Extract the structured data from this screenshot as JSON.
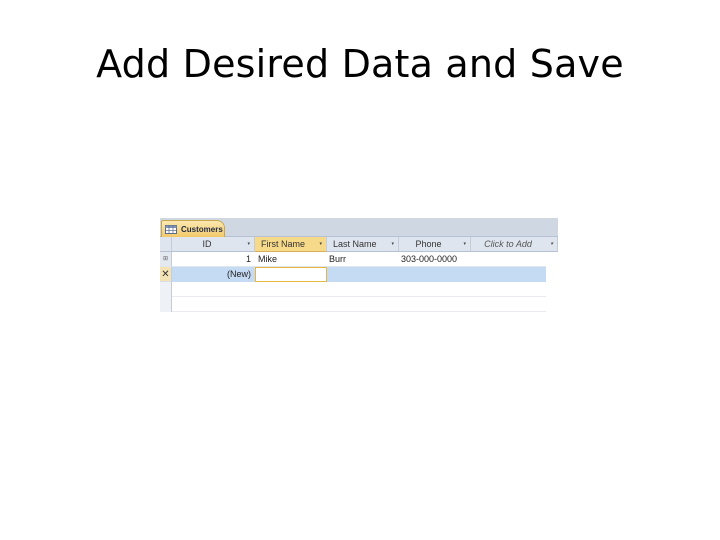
{
  "slide": {
    "title": "Add Desired Data and Save"
  },
  "table_tab": {
    "label": "Customers",
    "icon": "table-icon"
  },
  "columns": [
    {
      "label": "ID",
      "dropdown": "▾"
    },
    {
      "label": "First Name",
      "dropdown": "▾"
    },
    {
      "label": "Last Name",
      "dropdown": "▾"
    },
    {
      "label": "Phone",
      "dropdown": "▾"
    },
    {
      "label": "Click to Add",
      "dropdown": "▾"
    }
  ],
  "rows": [
    {
      "selector": "⊞",
      "id": "1",
      "first_name": "Mike",
      "last_name": "Burr",
      "phone": "303-000-0000"
    }
  ],
  "new_row": {
    "selector": "✕",
    "id": "(New)",
    "first_name": ""
  },
  "colors": {
    "tab_strip": "#cfd7e3",
    "active_tab": "#f3c969",
    "new_row_highlight": "#c4dbf3",
    "current_cell_border": "#e5b742"
  }
}
